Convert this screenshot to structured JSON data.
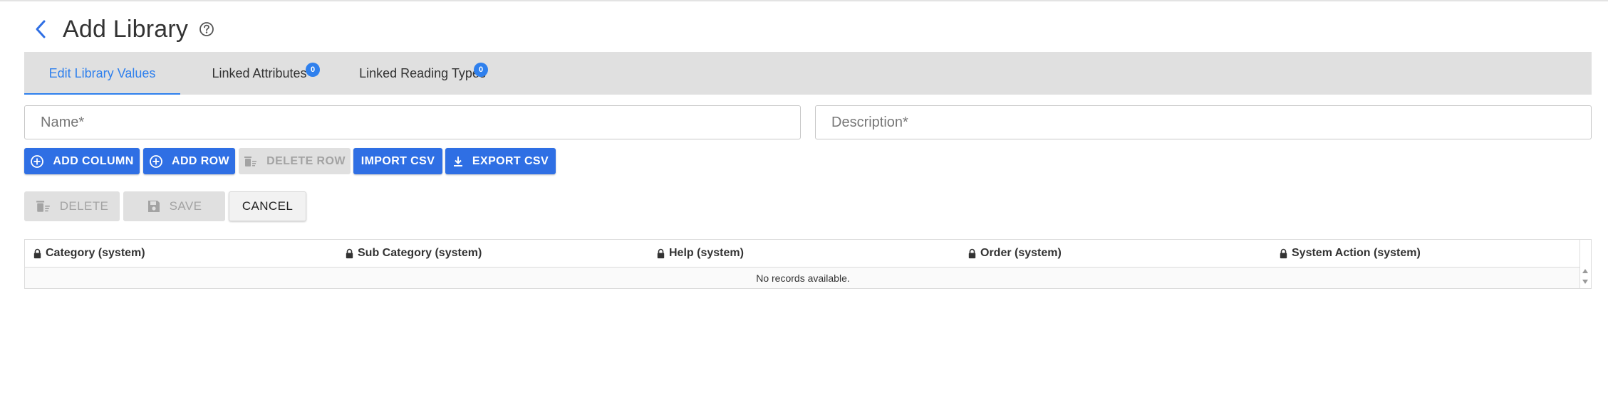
{
  "page": {
    "title": "Add Library",
    "back_icon": "chevron-left-icon",
    "help_icon": "help-circle-icon"
  },
  "tabs": [
    {
      "label": "Edit Library Values",
      "active": true
    },
    {
      "label": "Linked Attributes",
      "count": "0"
    },
    {
      "label": "Linked Reading Types",
      "count": "0"
    }
  ],
  "form": {
    "name_placeholder": "Name*",
    "description_placeholder": "Description*",
    "name_value": "",
    "description_value": ""
  },
  "toolbar": {
    "add_column": "ADD COLUMN",
    "add_row": "ADD ROW",
    "delete_row": "DELETE ROW",
    "import_csv": "IMPORT CSV",
    "export_csv": "EXPORT CSV"
  },
  "actions": {
    "delete": "DELETE",
    "save": "SAVE",
    "cancel": "CANCEL"
  },
  "grid": {
    "columns": [
      "Category (system)",
      "Sub Category (system)",
      "Help (system)",
      "Order (system)",
      "System Action (system)"
    ],
    "empty_text": "No records available."
  },
  "colors": {
    "accent": "#2f80ed",
    "primary_button": "#2f6fe4",
    "tab_bar": "#e0e0e0",
    "disabled": "#e0e0e0"
  }
}
